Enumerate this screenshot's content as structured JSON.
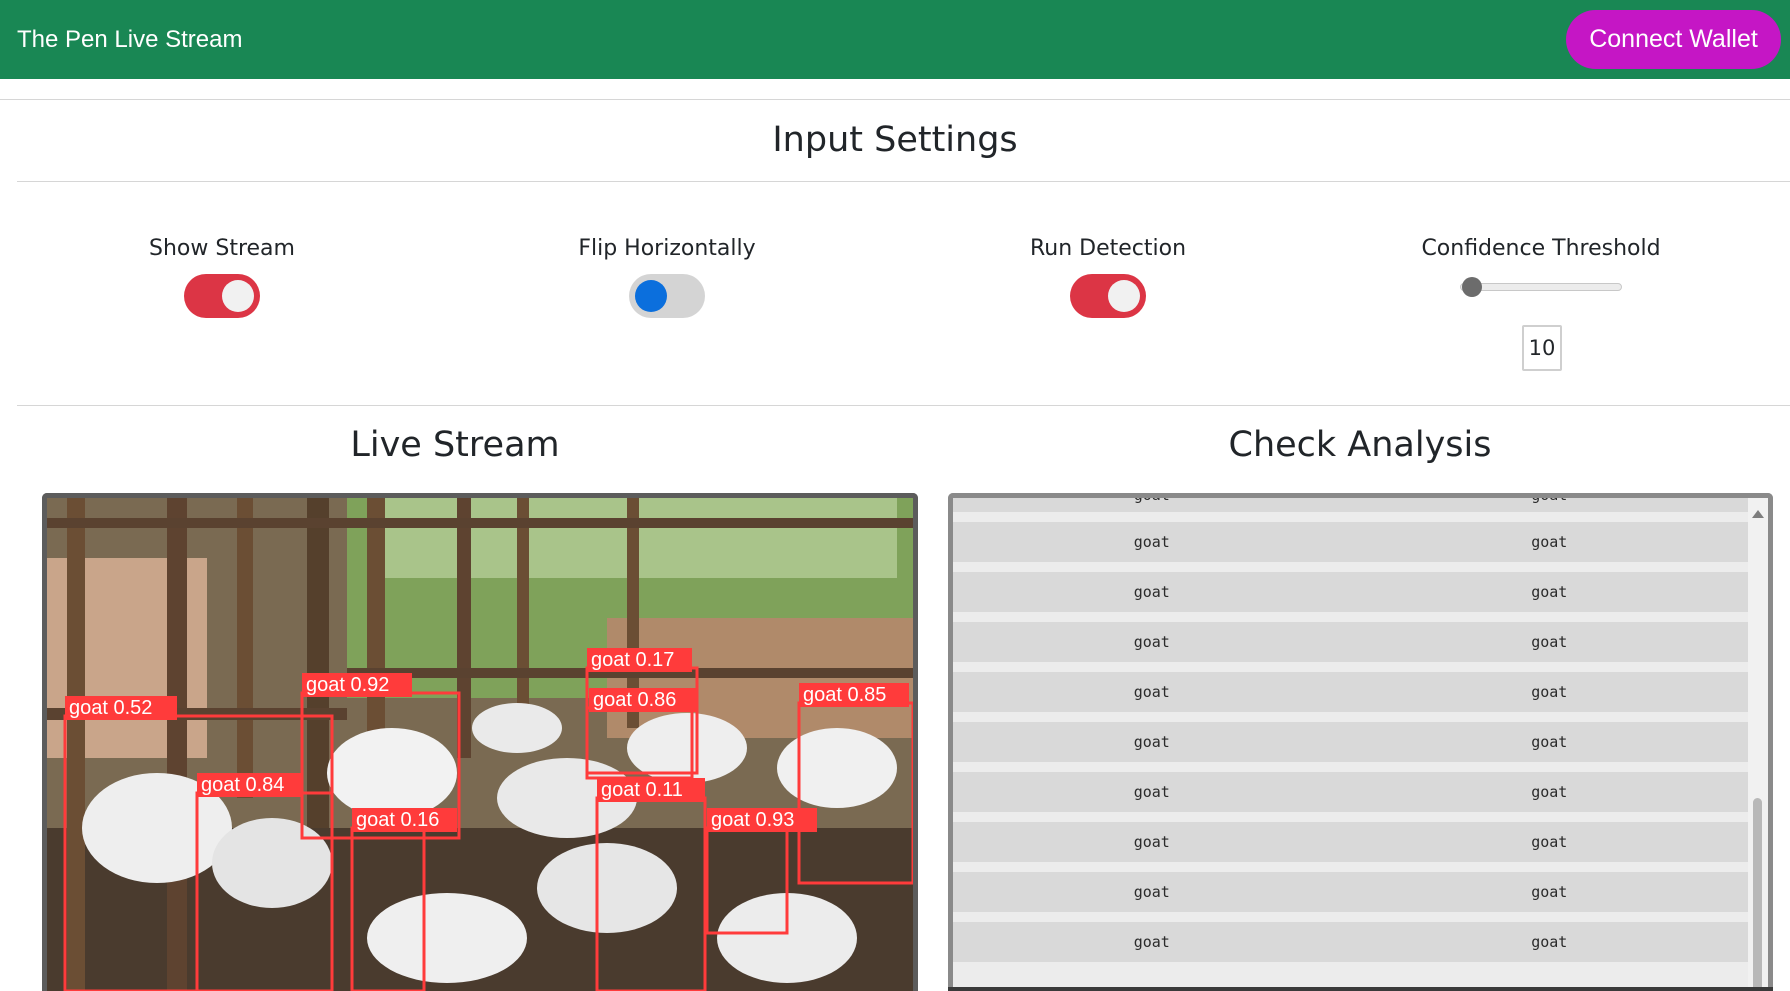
{
  "header": {
    "title": "The Pen Live Stream",
    "connect_label": "Connect Wallet",
    "bg_color": "#198754",
    "button_color": "#c516c5"
  },
  "input_settings": {
    "title": "Input Settings",
    "show_stream": {
      "label": "Show Stream",
      "on": true
    },
    "flip_horizontally": {
      "label": "Flip Horizontally",
      "on": false
    },
    "run_detection": {
      "label": "Run Detection",
      "on": true
    },
    "confidence_threshold": {
      "label": "Confidence Threshold",
      "value": "10"
    }
  },
  "live_stream": {
    "title": "Live Stream",
    "detections": [
      "goat 0.52",
      "goat 0.92",
      "goat 0.17",
      "goat 0.86",
      "goat 0.85",
      "goat 0.84",
      "goat 0.16",
      "goat 0.11",
      "goat 0.93"
    ]
  },
  "check_analysis": {
    "title": "Check Analysis",
    "rows": [
      [
        "goat",
        "goat"
      ],
      [
        "goat",
        "goat"
      ],
      [
        "goat",
        "goat"
      ],
      [
        "goat",
        "goat"
      ],
      [
        "goat",
        "goat"
      ],
      [
        "goat",
        "goat"
      ],
      [
        "goat",
        "goat"
      ],
      [
        "goat",
        "goat"
      ],
      [
        "goat",
        "goat"
      ],
      [
        "goat",
        "goat"
      ]
    ]
  }
}
